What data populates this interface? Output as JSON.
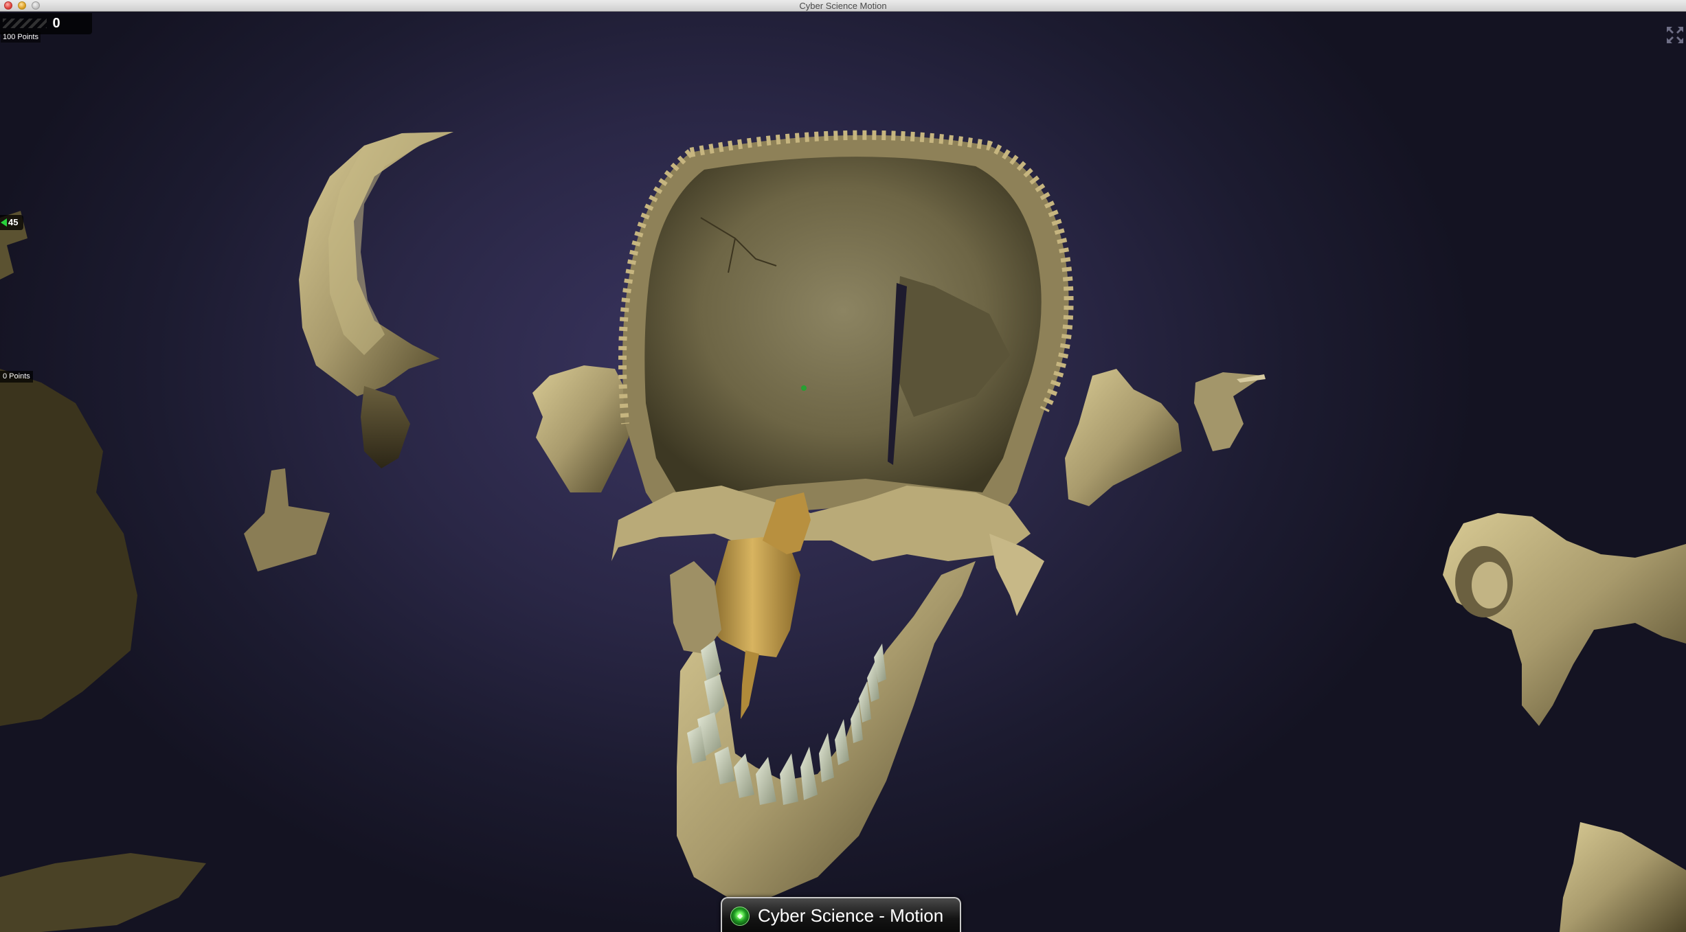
{
  "window": {
    "title": "Cyber Science Motion"
  },
  "hud": {
    "score_value": "0",
    "score_points_label": "100 Points",
    "timer_value": "45",
    "secondary_points_label": "0 Points"
  },
  "banner": {
    "title": "Cyber Science - Motion"
  },
  "colors": {
    "bone": "#a89a6c",
    "bone_highlight": "#d8ca94",
    "bone_shadow": "#3e3620",
    "highlighted_bone": "#c9a04a",
    "teeth": "#b7bea7",
    "background": "#2a2746",
    "timer_arrow": "#28d13a"
  },
  "icons": {
    "fullscreen": "fullscreen-icon",
    "banner": "green-gem-icon"
  }
}
